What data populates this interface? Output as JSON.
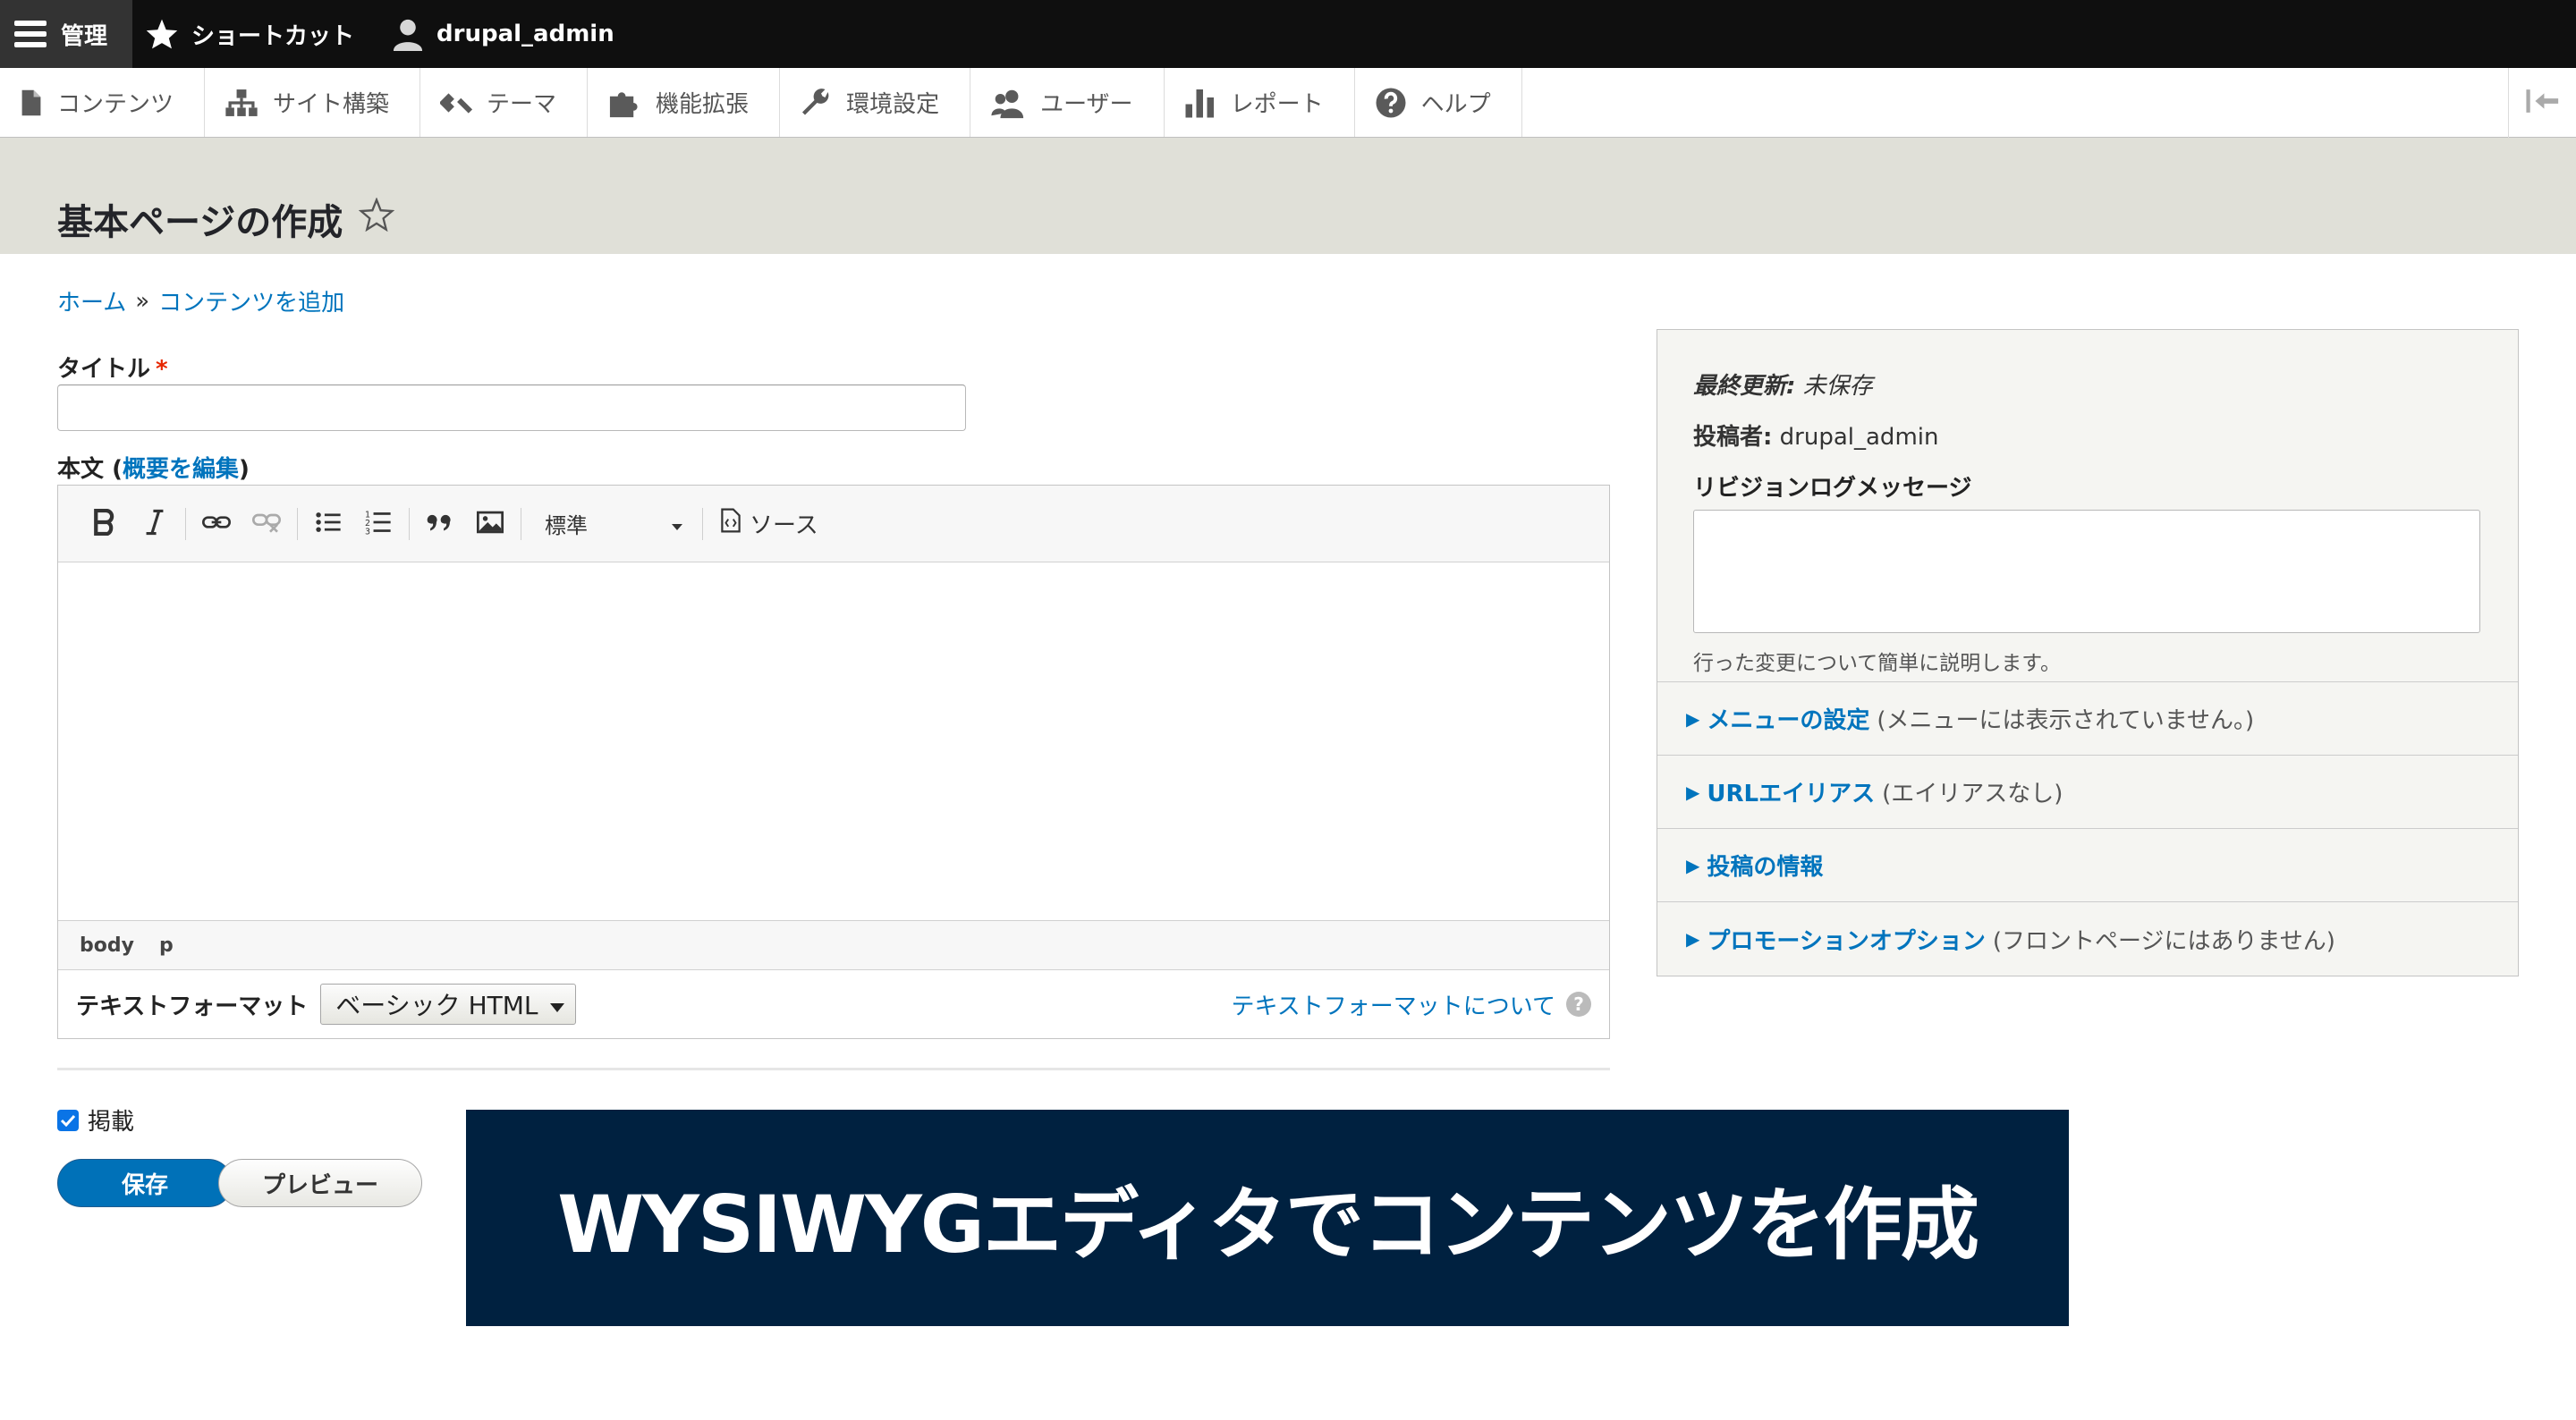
{
  "toolbar": {
    "manage_label": "管理",
    "shortcuts_label": "ショートカット",
    "user_label": "drupal_admin"
  },
  "tray": {
    "items": [
      {
        "label": "コンテンツ",
        "icon": "file-icon"
      },
      {
        "label": "サイト構築",
        "icon": "sitemap-icon"
      },
      {
        "label": "テーマ",
        "icon": "paintbrush-icon"
      },
      {
        "label": "機能拡張",
        "icon": "puzzle-icon"
      },
      {
        "label": "環境設定",
        "icon": "wrench-icon"
      },
      {
        "label": "ユーザー",
        "icon": "people-icon"
      },
      {
        "label": "レポート",
        "icon": "bar-chart-icon"
      },
      {
        "label": "ヘルプ",
        "icon": "help-icon"
      }
    ]
  },
  "page": {
    "title": "基本ページの作成"
  },
  "breadcrumb": {
    "home": "ホーム",
    "separator": "»",
    "add_content": "コンテンツを追加"
  },
  "form": {
    "title_label": "タイトル",
    "required_mark": "*",
    "title_value": "",
    "body_label": "本文",
    "body_paren_open": "(",
    "body_summary_link": "概要を編集",
    "body_paren_close": ")",
    "editor": {
      "format_dropdown": "標準",
      "source_label": "ソース",
      "path": [
        "body",
        "p"
      ]
    },
    "text_format_label": "テキストフォーマット",
    "text_format_value": "ベーシック HTML",
    "text_format_help": "テキストフォーマットについて",
    "help_glyph": "?",
    "published_label": "掲載",
    "published": true,
    "save_label": "保存",
    "preview_label": "プレビュー"
  },
  "sidebar": {
    "last_updated_label": "最終更新:",
    "last_updated_value": "未保存",
    "author_label": "投稿者:",
    "author_value": "drupal_admin",
    "revision_label": "リビジョンログメッセージ",
    "revision_value": "",
    "revision_description": "行った変更について簡単に説明します。",
    "details": [
      {
        "link": "メニューの設定",
        "summary": "(メニューには表示されていません。)"
      },
      {
        "link": "URLエイリアス",
        "summary": "(エイリアスなし)"
      },
      {
        "link": "投稿の情報",
        "summary": ""
      },
      {
        "link": "プロモーションオプション",
        "summary": "(フロントページにはありません)"
      }
    ]
  },
  "banner": {
    "text": "WYSIWYGエディタでコンテンツを作成"
  },
  "colors": {
    "link": "#0074bd",
    "primary_button": "#0071b8",
    "banner_bg": "#002140",
    "header_bg": "#e0e0d8",
    "toolbar_bg": "#0f0f0f"
  }
}
